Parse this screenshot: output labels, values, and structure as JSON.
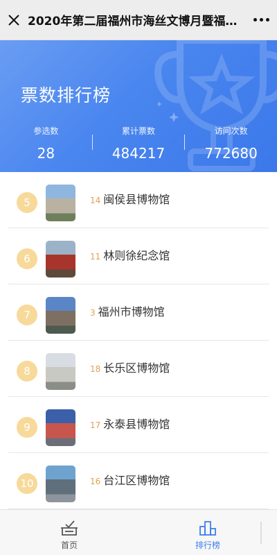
{
  "topbar": {
    "title": "2020年第二届福州市海丝文博月暨福州...",
    "close_icon": "close-icon",
    "more_icon": "more-icon"
  },
  "banner": {
    "heading": "票数排行榜",
    "stats": [
      {
        "label": "参选数",
        "value": "28"
      },
      {
        "label": "累计票数",
        "value": "484217"
      },
      {
        "label": "访问次数",
        "value": "772680"
      }
    ]
  },
  "list": [
    {
      "rank": "5",
      "votes": "14",
      "name": "闽侯县博物馆",
      "sky": "#8fb6df",
      "building": "#b9b2a3",
      "ground": "#6f7f5c"
    },
    {
      "rank": "6",
      "votes": "11",
      "name": "林则徐纪念馆",
      "sky": "#9bb3c8",
      "building": "#a8352c",
      "ground": "#5e4a3a"
    },
    {
      "rank": "7",
      "votes": "3",
      "name": "福州市博物馆",
      "sky": "#5a86c7",
      "building": "#7d6f62",
      "ground": "#4e5a4f"
    },
    {
      "rank": "8",
      "votes": "18",
      "name": "长乐区博物馆",
      "sky": "#d8dde3",
      "building": "#c9c9c3",
      "ground": "#8b8d87"
    },
    {
      "rank": "9",
      "votes": "17",
      "name": "永泰县博物馆",
      "sky": "#3b5fa8",
      "building": "#c9564e",
      "ground": "#6b6e78"
    },
    {
      "rank": "10",
      "votes": "16",
      "name": "台江区博物馆",
      "sky": "#6fa3cf",
      "building": "#5f6f7c",
      "ground": "#8d949b"
    }
  ],
  "tabbar": {
    "items": [
      {
        "label": "首页",
        "icon": "ballot-box-icon"
      },
      {
        "label": "排行榜",
        "icon": "ranking-podium-icon"
      }
    ]
  },
  "colors": {
    "banner_blue": "#4a86ef",
    "rank_badge": "#f7d99a",
    "votes_orange": "#e0a057",
    "active_tab": "#3d7fea"
  }
}
